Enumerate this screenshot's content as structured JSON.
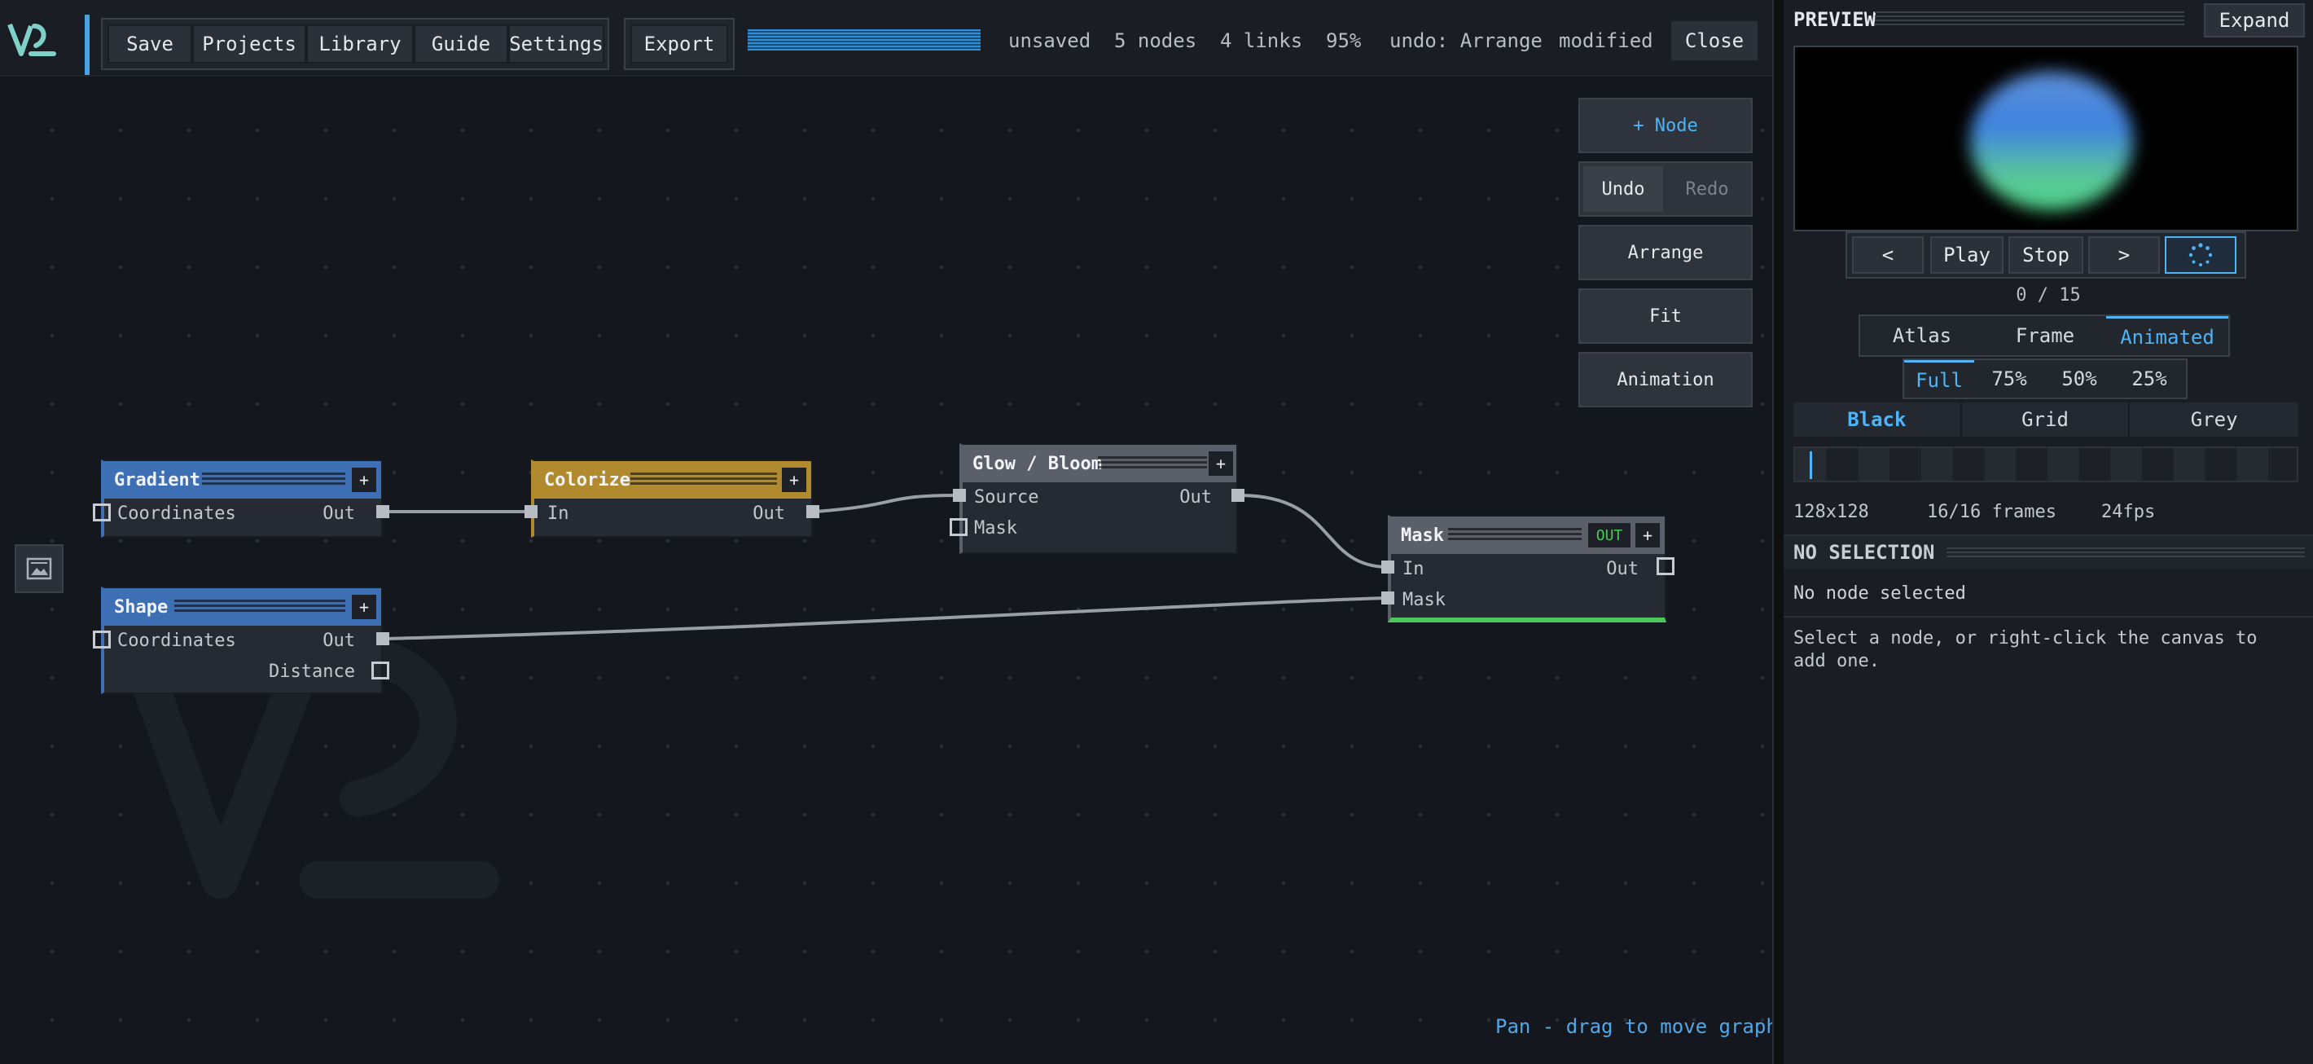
{
  "toolbar": {
    "buttons": [
      "Save",
      "Projects",
      "Library",
      "Guide",
      "Settings"
    ],
    "export_label": "Export",
    "progress": 1.0,
    "status": [
      "unsaved",
      "5 nodes",
      "4 links",
      "95%",
      "undo: Arrange",
      "modified"
    ],
    "close_label": "Close"
  },
  "tools": {
    "add_node": "+ Node",
    "undo": "Undo",
    "redo": "Redo",
    "arrange": "Arrange",
    "fit": "Fit",
    "animation": "Animation"
  },
  "nodes": {
    "gradient": {
      "title": "Gradient",
      "plus": "+",
      "in": "Coordinates",
      "out": "Out",
      "color": "#3d6fb5"
    },
    "colorize": {
      "title": "Colorize",
      "plus": "+",
      "in": "In",
      "out": "Out",
      "color": "#b08a2c"
    },
    "glow": {
      "title": "Glow / Bloom",
      "plus": "+",
      "in": "Source",
      "out": "Out",
      "mask": "Mask",
      "color": "#5a5f69"
    },
    "shape": {
      "title": "Shape",
      "plus": "+",
      "in": "Coordinates",
      "out": "Out",
      "distance": "Distance",
      "color": "#3d6fb5"
    },
    "mask": {
      "title": "Mask",
      "badge": "OUT",
      "plus": "+",
      "in": "In",
      "out": "Out",
      "mask": "Mask",
      "color": "#5a5f69"
    }
  },
  "hint": "Pan - drag to move graph",
  "panel": {
    "title": "PREVIEW",
    "expand": "Expand",
    "playback": {
      "prev": "<",
      "play": "Play",
      "stop": "Stop",
      "next": ">"
    },
    "frame_counter": "0 / 15",
    "view_modes": [
      "Atlas",
      "Frame",
      "Animated"
    ],
    "active_view": "Animated",
    "scales": [
      "Full",
      "75%",
      "50%",
      "25%"
    ],
    "active_scale": "Full",
    "backgrounds": [
      "Black",
      "Grid",
      "Grey"
    ],
    "active_background": "Black",
    "info": {
      "size": "128x128",
      "frames": "16/16 frames",
      "fps": "24fps"
    },
    "selection": {
      "header": "NO SELECTION",
      "status": "No node selected",
      "help": "Select a node, or right-click the canvas to add one."
    }
  },
  "colors": {
    "accent": "#4fb4f5",
    "output_green": "#4cc85a"
  }
}
